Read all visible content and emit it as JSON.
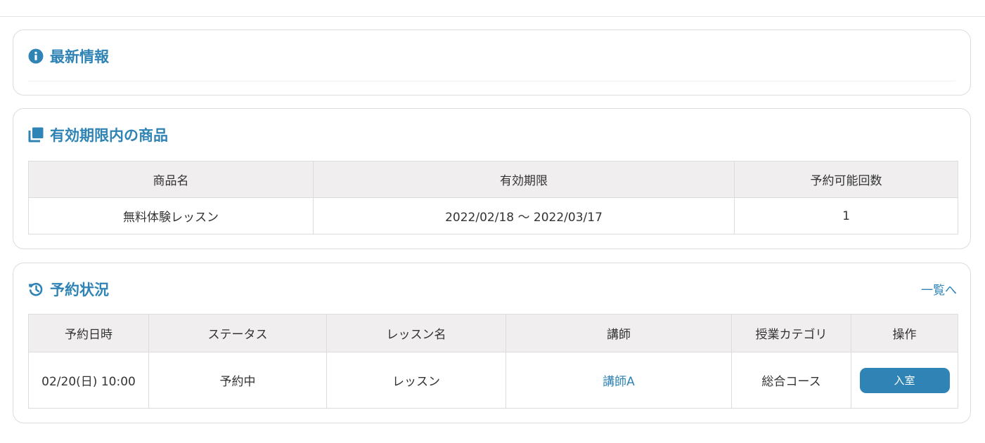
{
  "news": {
    "title": "最新情報"
  },
  "products": {
    "title": "有効期限内の商品",
    "headers": [
      "商品名",
      "有効期限",
      "予約可能回数"
    ],
    "rows": [
      {
        "name": "無料体験レッスン",
        "validity": "2022/02/18 〜 2022/03/17",
        "remaining": "1"
      }
    ]
  },
  "reservations": {
    "title": "予約状況",
    "list_link": "一覧へ",
    "headers": [
      "予約日時",
      "ステータス",
      "レッスン名",
      "講師",
      "授業カテゴリ",
      "操作"
    ],
    "rows": [
      {
        "datetime": "02/20(日) 10:00",
        "status": "予約中",
        "lesson": "レッスン",
        "teacher": "講師A",
        "category": "総合コース",
        "action": "入室"
      }
    ]
  },
  "colors": {
    "accent": "#2f84b5",
    "header_bg": "#f0eeee",
    "border": "#dcdcdc"
  },
  "icons": {
    "news": "info-circle-icon",
    "products": "copy-icon",
    "reservations": "history-icon"
  }
}
